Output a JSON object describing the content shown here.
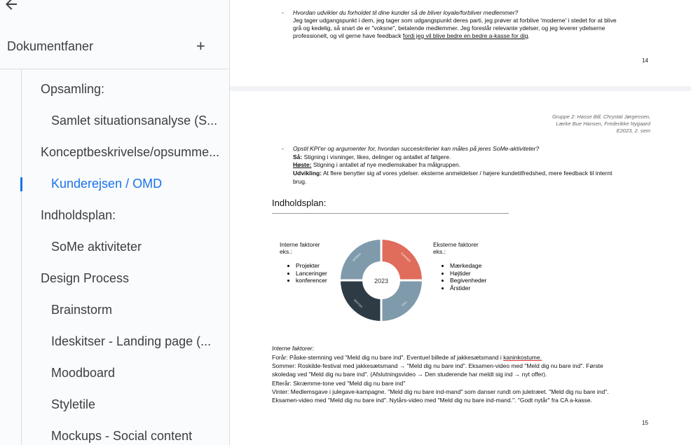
{
  "sidebar": {
    "header": "Dokumentfaner",
    "items": [
      {
        "label": "Opsamling:"
      },
      {
        "label": "Samlet situationsanalyse (S..."
      },
      {
        "label": "Konceptbeskrivelse/opsumme..."
      },
      {
        "label": "Kunderejsen / OMD"
      },
      {
        "label": "Indholdsplan:"
      },
      {
        "label": "SoMe aktiviteter"
      },
      {
        "label": "Design Process"
      },
      {
        "label": "Brainstorm"
      },
      {
        "label": "Ideskitser - Landing page (..."
      },
      {
        "label": "Moodboard"
      },
      {
        "label": "Styletile"
      },
      {
        "label": "Mockups - Social content"
      }
    ]
  },
  "page14": {
    "bullet_label": "-",
    "question": "Hvordan udvikler du forholdet til dine kunder så de bliver loyale/forbliver medlemmer?",
    "answer_l1": "Jeg tager udgangspunkt i dem, jeg tager som udgangspunkt deres parti, jeg prøver at forblive 'moderne' i stedet for at blive",
    "answer_l2": "grå og kedelig, så snart de er \"voksne\", betalende medlemmer. Jeg foreslår relevante ydelser, og jeg leverer ydelserne",
    "answer_l3a": "professionelt, og vil gerne have feedback ",
    "answer_l3b": "fordi jeg vil blive bedre en bedre a-kasse for dig",
    "answer_l3c": ".",
    "page_number": "14"
  },
  "page15": {
    "header_l1": "Gruppe 2: Hasse Bill, Chrystal Jørgensen,",
    "header_l2": "Lærke Bue Hansen, Frederikke Nygaard",
    "header_l3": "E2023, 2. sem",
    "bullet_label": "-",
    "kpi_question": "Opstil KPI'er og argumenter for, hvordan succeskriterier kan måles på jeres SoMe-aktiviteter?",
    "saa_label": "Så:",
    "saa_text": " Stigning i visninger, likes, delinger og antallet af følgere.",
    "hoste_label": "Høste:",
    "hoste_text": " Stigning i antallet af nye medlemskaber fra målgruppen.",
    "udv_label": "Udvikling:",
    "udv_text_l1": " At flere benytter sig af vores ydelser. eksterne anmeldelser / højere kundetilfredshed, mere feedback til internt",
    "udv_text_l2": "brug.",
    "section_title": "Indholdsplan",
    "section_colon": ":",
    "internal_title": "Interne faktorer",
    "internal_sub": "eks.:",
    "internal_items": [
      "Projekter",
      "Lanceringer",
      "konferencer"
    ],
    "external_title": "Eksterne faktorer",
    "external_sub": "eks.:",
    "external_items": [
      "Mærkedage",
      "Højtider",
      "Begivenheder",
      "Årstider"
    ],
    "wheel_center": "2023",
    "wheel_labels": {
      "spring": "SPRING",
      "summer": "SUMMER",
      "fall": "FALL",
      "winter": "WINTER"
    },
    "factors_heading": "Interne faktorer:",
    "lines": [
      "Forår: Påske-stemning ved \"Meld dig nu bare ind\". Eventuel billede af jakkesætsmand i ",
      "Sommer: Roskilde-festival med jakkesætsmand → \"Meld dig nu bare ind\". Eksamen-video med \"Meld dig nu bare ind\". Første",
      "skoledag ved \"Meld dig nu bare ind\". (Afslutningsvideo → Den studerende har meldt sig ind → nyt offer).",
      "Efterår: Skræmme-tone ved \"Meld dig nu bare ind\"",
      "Vinter: Medlemsgave i julegave-kampagne. \"Meld dig nu bare ind-mand\" som danser rundt om juletræet. \"Meld dig nu bare ind\".",
      "Eksamen-video med \"Meld dig nu bare ind\". Nytårs-video med \"Meld dig nu bare ind-mand.\". \"Godt nytår\" fra CA a-kasse."
    ],
    "line1_underlined": "kaninkostume.",
    "page_number": "15"
  },
  "colors": {
    "accent": "#1a73e8",
    "wheel_spring": "#7f9aab",
    "wheel_summer": "#e06c5c",
    "wheel_fall": "#7f9aab",
    "wheel_winter": "#2e3b45"
  }
}
